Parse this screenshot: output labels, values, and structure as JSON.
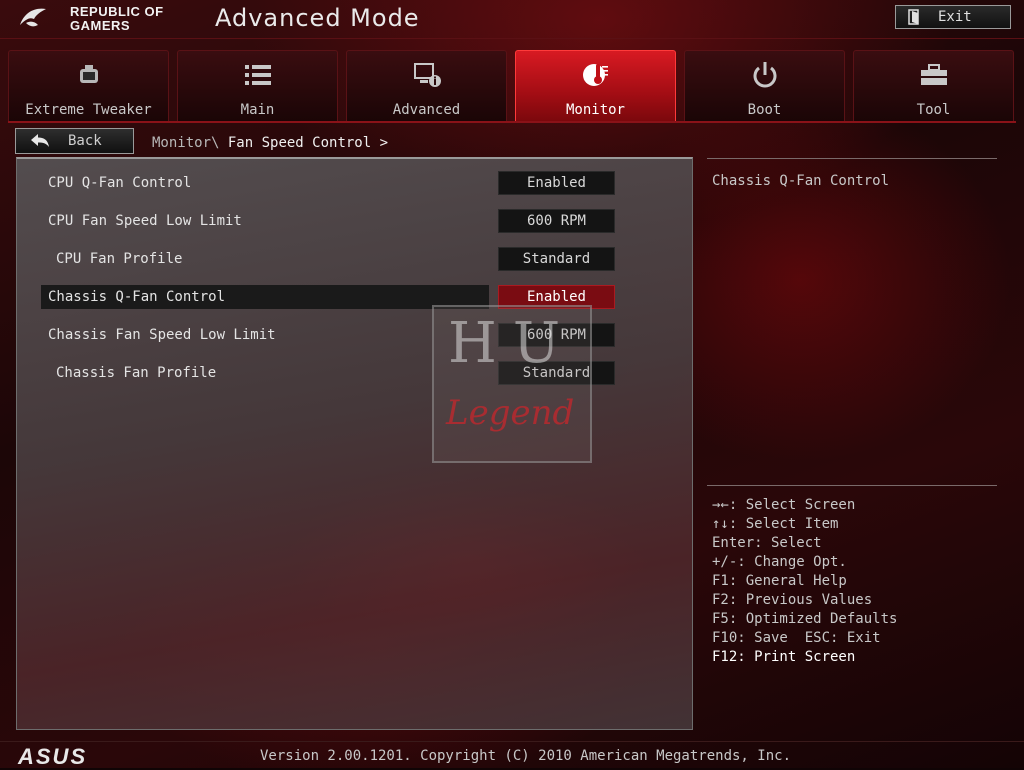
{
  "header": {
    "brand_line1": "REPUBLIC OF",
    "brand_line2": "GAMERS",
    "mode_title": "Advanced Mode",
    "exit_label": "Exit"
  },
  "tabs": [
    {
      "label": "Extreme Tweaker",
      "icon": "gauge-icon"
    },
    {
      "label": "Main",
      "icon": "list-icon"
    },
    {
      "label": "Advanced",
      "icon": "monitor-info-icon"
    },
    {
      "label": "Monitor",
      "icon": "thermometer-icon",
      "active": true
    },
    {
      "label": "Boot",
      "icon": "power-icon"
    },
    {
      "label": "Tool",
      "icon": "toolbox-icon"
    }
  ],
  "nav": {
    "back_label": "Back",
    "breadcrumb_parent": "Monitor\\",
    "breadcrumb_current": "Fan Speed Control >"
  },
  "settings": [
    {
      "label": "CPU Q-Fan Control",
      "value": "Enabled"
    },
    {
      "label": "CPU Fan Speed Low Limit",
      "value": "600 RPM"
    },
    {
      "label": "CPU Fan Profile",
      "value": "Standard"
    },
    {
      "label": "Chassis Q-Fan Control",
      "value": "Enabled",
      "selected": true
    },
    {
      "label": "Chassis Fan Speed Low Limit",
      "value": "600 RPM"
    },
    {
      "label": "Chassis Fan Profile",
      "value": "Standard"
    }
  ],
  "help": {
    "title": "Chassis Q-Fan Control",
    "keys": [
      "→←: Select Screen",
      "↑↓: Select Item",
      "Enter: Select",
      "+/-: Change Opt.",
      "F1: General Help",
      "F2: Previous Values",
      "F5: Optimized Defaults",
      "F10: Save  ESC: Exit",
      "F12: Print Screen"
    ]
  },
  "watermark": {
    "letters": "HU",
    "word": "Legend"
  },
  "footer": {
    "logo": "ASUS",
    "version": "Version 2.00.1201. Copyright (C) 2010 American Megatrends, Inc."
  },
  "colors": {
    "accent": "#c8121a",
    "selected_value_bg": "#7a0c12",
    "value_bg": "#141414"
  }
}
